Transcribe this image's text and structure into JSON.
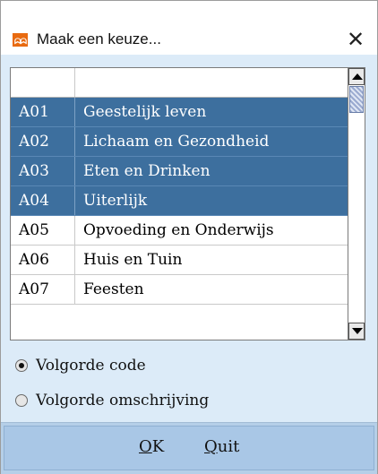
{
  "window": {
    "title": "Maak een keuze...",
    "close_glyph": "✕",
    "icon_text": "ᗣᗣ"
  },
  "list": {
    "rows": [
      {
        "code": "A01",
        "desc": "Geestelijk leven",
        "selected": true
      },
      {
        "code": "A02",
        "desc": "Lichaam en Gezondheid",
        "selected": true
      },
      {
        "code": "A03",
        "desc": "Eten en Drinken",
        "selected": true
      },
      {
        "code": "A04",
        "desc": "Uiterlijk",
        "selected": true
      },
      {
        "code": "A05",
        "desc": "Opvoeding en Onderwijs",
        "selected": false
      },
      {
        "code": "A06",
        "desc": "Huis en Tuin",
        "selected": false
      },
      {
        "code": "A07",
        "desc": "Feesten",
        "selected": false
      }
    ]
  },
  "options": {
    "sort_code": "Volgorde code",
    "sort_desc": "Volgorde omschrijving",
    "selected": "sort_code"
  },
  "buttons": {
    "ok_mnemonic": "O",
    "ok_rest": "K",
    "quit_mnemonic": "Q",
    "quit_rest": "uit"
  },
  "colors": {
    "selection": "#3d6f9e",
    "client_bg": "#dcebf8",
    "button_bar": "#a9c7e6",
    "app_icon": "#e86a10"
  }
}
